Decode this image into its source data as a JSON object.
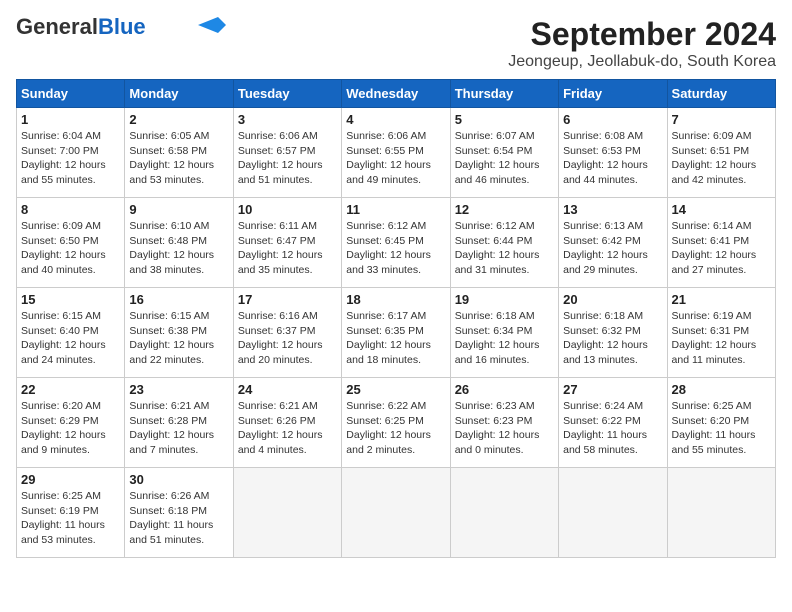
{
  "logo": {
    "general": "General",
    "blue": "Blue",
    "arrow_color": "#1e88e5"
  },
  "title": "September 2024",
  "subtitle": "Jeongeup, Jeollabuk-do, South Korea",
  "days_of_week": [
    "Sunday",
    "Monday",
    "Tuesday",
    "Wednesday",
    "Thursday",
    "Friday",
    "Saturday"
  ],
  "weeks": [
    [
      {
        "day": "1",
        "info": "Sunrise: 6:04 AM\nSunset: 7:00 PM\nDaylight: 12 hours\nand 55 minutes."
      },
      {
        "day": "2",
        "info": "Sunrise: 6:05 AM\nSunset: 6:58 PM\nDaylight: 12 hours\nand 53 minutes."
      },
      {
        "day": "3",
        "info": "Sunrise: 6:06 AM\nSunset: 6:57 PM\nDaylight: 12 hours\nand 51 minutes."
      },
      {
        "day": "4",
        "info": "Sunrise: 6:06 AM\nSunset: 6:55 PM\nDaylight: 12 hours\nand 49 minutes."
      },
      {
        "day": "5",
        "info": "Sunrise: 6:07 AM\nSunset: 6:54 PM\nDaylight: 12 hours\nand 46 minutes."
      },
      {
        "day": "6",
        "info": "Sunrise: 6:08 AM\nSunset: 6:53 PM\nDaylight: 12 hours\nand 44 minutes."
      },
      {
        "day": "7",
        "info": "Sunrise: 6:09 AM\nSunset: 6:51 PM\nDaylight: 12 hours\nand 42 minutes."
      }
    ],
    [
      {
        "day": "8",
        "info": "Sunrise: 6:09 AM\nSunset: 6:50 PM\nDaylight: 12 hours\nand 40 minutes."
      },
      {
        "day": "9",
        "info": "Sunrise: 6:10 AM\nSunset: 6:48 PM\nDaylight: 12 hours\nand 38 minutes."
      },
      {
        "day": "10",
        "info": "Sunrise: 6:11 AM\nSunset: 6:47 PM\nDaylight: 12 hours\nand 35 minutes."
      },
      {
        "day": "11",
        "info": "Sunrise: 6:12 AM\nSunset: 6:45 PM\nDaylight: 12 hours\nand 33 minutes."
      },
      {
        "day": "12",
        "info": "Sunrise: 6:12 AM\nSunset: 6:44 PM\nDaylight: 12 hours\nand 31 minutes."
      },
      {
        "day": "13",
        "info": "Sunrise: 6:13 AM\nSunset: 6:42 PM\nDaylight: 12 hours\nand 29 minutes."
      },
      {
        "day": "14",
        "info": "Sunrise: 6:14 AM\nSunset: 6:41 PM\nDaylight: 12 hours\nand 27 minutes."
      }
    ],
    [
      {
        "day": "15",
        "info": "Sunrise: 6:15 AM\nSunset: 6:40 PM\nDaylight: 12 hours\nand 24 minutes."
      },
      {
        "day": "16",
        "info": "Sunrise: 6:15 AM\nSunset: 6:38 PM\nDaylight: 12 hours\nand 22 minutes."
      },
      {
        "day": "17",
        "info": "Sunrise: 6:16 AM\nSunset: 6:37 PM\nDaylight: 12 hours\nand 20 minutes."
      },
      {
        "day": "18",
        "info": "Sunrise: 6:17 AM\nSunset: 6:35 PM\nDaylight: 12 hours\nand 18 minutes."
      },
      {
        "day": "19",
        "info": "Sunrise: 6:18 AM\nSunset: 6:34 PM\nDaylight: 12 hours\nand 16 minutes."
      },
      {
        "day": "20",
        "info": "Sunrise: 6:18 AM\nSunset: 6:32 PM\nDaylight: 12 hours\nand 13 minutes."
      },
      {
        "day": "21",
        "info": "Sunrise: 6:19 AM\nSunset: 6:31 PM\nDaylight: 12 hours\nand 11 minutes."
      }
    ],
    [
      {
        "day": "22",
        "info": "Sunrise: 6:20 AM\nSunset: 6:29 PM\nDaylight: 12 hours\nand 9 minutes."
      },
      {
        "day": "23",
        "info": "Sunrise: 6:21 AM\nSunset: 6:28 PM\nDaylight: 12 hours\nand 7 minutes."
      },
      {
        "day": "24",
        "info": "Sunrise: 6:21 AM\nSunset: 6:26 PM\nDaylight: 12 hours\nand 4 minutes."
      },
      {
        "day": "25",
        "info": "Sunrise: 6:22 AM\nSunset: 6:25 PM\nDaylight: 12 hours\nand 2 minutes."
      },
      {
        "day": "26",
        "info": "Sunrise: 6:23 AM\nSunset: 6:23 PM\nDaylight: 12 hours\nand 0 minutes."
      },
      {
        "day": "27",
        "info": "Sunrise: 6:24 AM\nSunset: 6:22 PM\nDaylight: 11 hours\nand 58 minutes."
      },
      {
        "day": "28",
        "info": "Sunrise: 6:25 AM\nSunset: 6:20 PM\nDaylight: 11 hours\nand 55 minutes."
      }
    ],
    [
      {
        "day": "29",
        "info": "Sunrise: 6:25 AM\nSunset: 6:19 PM\nDaylight: 11 hours\nand 53 minutes."
      },
      {
        "day": "30",
        "info": "Sunrise: 6:26 AM\nSunset: 6:18 PM\nDaylight: 11 hours\nand 51 minutes."
      },
      {
        "day": "",
        "info": ""
      },
      {
        "day": "",
        "info": ""
      },
      {
        "day": "",
        "info": ""
      },
      {
        "day": "",
        "info": ""
      },
      {
        "day": "",
        "info": ""
      }
    ]
  ]
}
